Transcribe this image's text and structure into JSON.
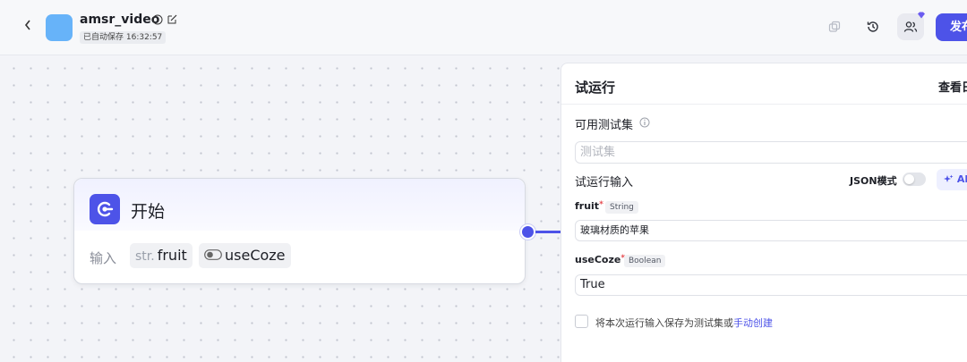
{
  "header": {
    "back_icon": "chevron-left-icon",
    "app_icon_color": "#67b3f9",
    "app_name": "amsr_video",
    "autosave": "已自动保存 16:32:57",
    "publish_label": "发布",
    "icons": [
      "copy-icon",
      "history-icon",
      "collaborators-icon"
    ]
  },
  "canvas": {
    "start_node": {
      "title": "开始",
      "input_label": "输入",
      "inputs": [
        {
          "type": "str.",
          "name": "fruit"
        },
        {
          "type": "toggle",
          "name": "useCoze"
        }
      ]
    }
  },
  "panel": {
    "title": "试运行",
    "view_link": "查看日",
    "testset_label": "可用测试集",
    "testset_placeholder": "测试集",
    "run_input_label": "试运行输入",
    "json_mode_label": "JSON模式",
    "ai_button": "AI",
    "fields": [
      {
        "name": "fruit",
        "required": "*",
        "type": "String",
        "value": "玻璃材质的苹果"
      },
      {
        "name": "useCoze",
        "required": "*",
        "type": "Boolean",
        "value": "True"
      }
    ],
    "save_text": "将本次运行输入保存为测试集或",
    "save_link": "手动创建"
  },
  "colors": {
    "accent": "#4d53e8",
    "required": "#e5484d"
  }
}
